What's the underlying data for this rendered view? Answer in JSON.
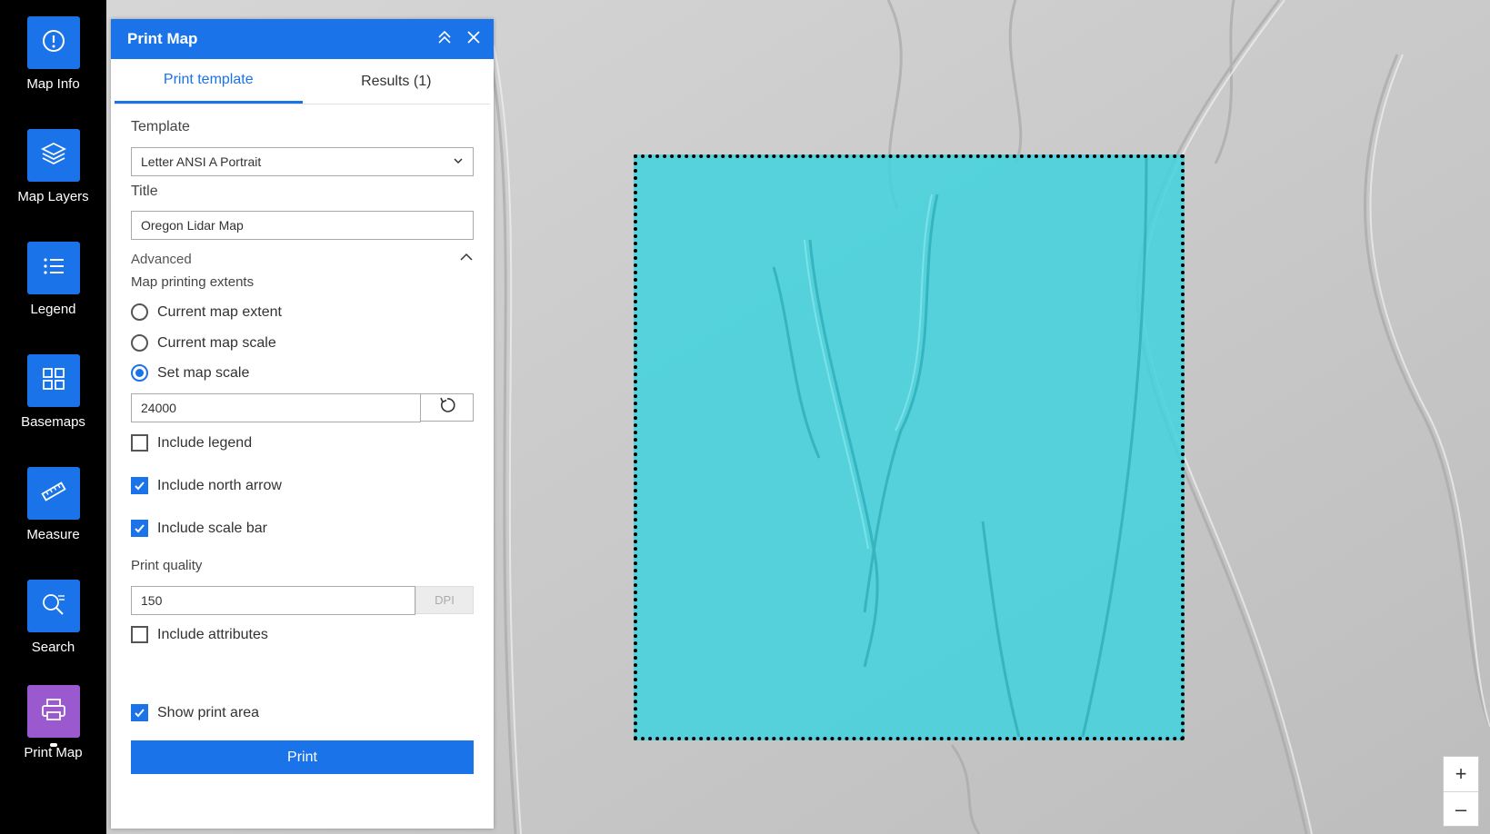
{
  "rail": {
    "items": [
      {
        "label": "Map Info",
        "icon": "info-icon"
      },
      {
        "label": "Map Layers",
        "icon": "layers-icon"
      },
      {
        "label": "Legend",
        "icon": "legend-icon"
      },
      {
        "label": "Basemaps",
        "icon": "basemap-grid-icon"
      },
      {
        "label": "Measure",
        "icon": "ruler-icon"
      },
      {
        "label": "Search",
        "icon": "search-icon"
      },
      {
        "label": "Print Map",
        "icon": "printer-icon",
        "active": true
      }
    ]
  },
  "panel": {
    "title": "Print Map",
    "tabs": [
      {
        "label": "Print template",
        "active": true
      },
      {
        "label": "Results (1)",
        "active": false
      }
    ],
    "template_label": "Template",
    "template_value": "Letter ANSI A Portrait",
    "title_label": "Title",
    "title_value": "Oregon Lidar Map",
    "advanced_label": "Advanced",
    "extents_label": "Map printing extents",
    "extent_options": [
      {
        "label": "Current map extent",
        "selected": false
      },
      {
        "label": "Current map scale",
        "selected": false
      },
      {
        "label": "Set map scale",
        "selected": true
      }
    ],
    "scale_value": "24000",
    "include_legend": {
      "label": "Include legend",
      "checked": false
    },
    "include_north_arrow": {
      "label": "Include north arrow",
      "checked": true
    },
    "include_scale_bar": {
      "label": "Include scale bar",
      "checked": true
    },
    "print_quality_label": "Print quality",
    "print_quality_value": "150",
    "dpi_label": "DPI",
    "include_attributes": {
      "label": "Include attributes",
      "checked": false
    },
    "show_print_area": {
      "label": "Show print area",
      "checked": true
    },
    "print_button": "Print"
  },
  "zoom": {
    "in": "+",
    "out": "–"
  },
  "colors": {
    "accent": "#1a73e8",
    "active_tool": "#9b59d0",
    "print_area": "#40d2de"
  }
}
